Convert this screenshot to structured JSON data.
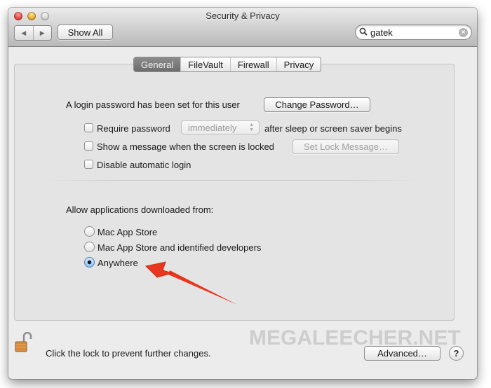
{
  "window": {
    "title": "Security & Privacy",
    "traffic_lights": [
      "close",
      "minimize",
      "zoom"
    ]
  },
  "toolbar": {
    "back_icon": "◀",
    "forward_icon": "▶",
    "show_all_label": "Show All",
    "search": {
      "value": "gatek",
      "placeholder": "",
      "search_icon": "⚲",
      "clear_icon": "×"
    }
  },
  "tabs": [
    {
      "label": "General",
      "active": true
    },
    {
      "label": "FileVault",
      "active": false
    },
    {
      "label": "Firewall",
      "active": false
    },
    {
      "label": "Privacy",
      "active": false
    }
  ],
  "general": {
    "login_password_text": "A login password has been set for this user",
    "change_password_label": "Change Password…",
    "require_password": {
      "label": "Require password",
      "checked": false,
      "delay_value": "immediately",
      "suffix": "after sleep or screen saver begins"
    },
    "show_message": {
      "label": "Show a message when the screen is locked",
      "checked": false,
      "button_label": "Set Lock Message…"
    },
    "disable_auto_login": {
      "label": "Disable automatic login",
      "checked": false
    },
    "allow_apps": {
      "heading": "Allow applications downloaded from:",
      "options": [
        {
          "label": "Mac App Store",
          "selected": false
        },
        {
          "label": "Mac App Store and identified developers",
          "selected": false
        },
        {
          "label": "Anywhere",
          "selected": true
        }
      ]
    }
  },
  "footer": {
    "lock_text": "Click the lock to prevent further changes.",
    "advanced_label": "Advanced…",
    "help_label": "?"
  },
  "annotation": {
    "arrow_color": "#e8361f",
    "watermark": "MEGALEECHER.NET"
  }
}
